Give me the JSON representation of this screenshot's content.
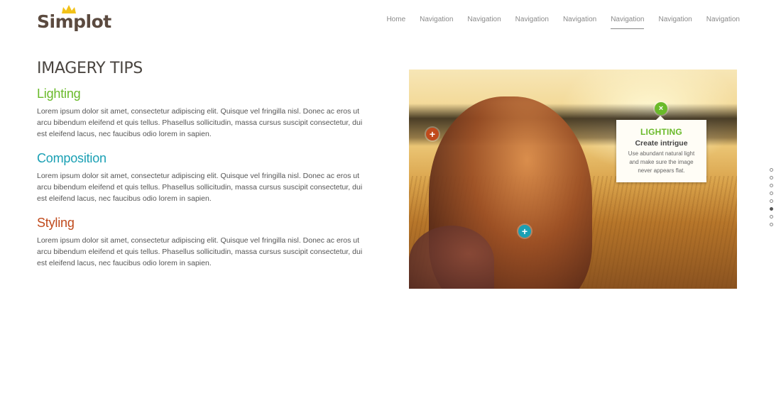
{
  "brand": {
    "name": "Simplot",
    "crown_color": "#f2c218"
  },
  "nav": {
    "items": [
      {
        "label": "Home",
        "active": false
      },
      {
        "label": "Navigation",
        "active": false
      },
      {
        "label": "Navigation",
        "active": false
      },
      {
        "label": "Navigation",
        "active": false
      },
      {
        "label": "Navigation",
        "active": false
      },
      {
        "label": "Navigation",
        "active": true
      },
      {
        "label": "Navigation",
        "active": false
      },
      {
        "label": "Navigation",
        "active": false
      }
    ]
  },
  "main": {
    "title": "IMAGERY TIPS",
    "sections": [
      {
        "heading": "Lighting",
        "color": "#6aba2a",
        "body": "Lorem ipsum dolor sit amet, consectetur adipiscing elit. Quisque vel fringilla nisl. Donec ac eros ut arcu bibendum eleifend et quis tellus. Phasellus sollicitudin, massa cursus suscipit consectetur, dui est eleifend lacus, nec faucibus odio lorem in sapien."
      },
      {
        "heading": "Composition",
        "color": "#1aa0b4",
        "body": "Lorem ipsum dolor sit amet, consectetur adipiscing elit. Quisque vel fringilla nisl. Donec ac eros ut arcu bibendum eleifend et quis tellus. Phasellus sollicitudin, massa cursus suscipit consectetur, dui est eleifend lacus, nec faucibus odio lorem in sapien."
      },
      {
        "heading": "Styling",
        "color": "#c04a1c",
        "body": "Lorem ipsum dolor sit amet, consectetur adipiscing elit. Quisque vel fringilla nisl. Donec ac eros ut arcu bibendum eleifend et quis tellus. Phasellus sollicitudin, massa cursus suscipit consectetur, dui est eleifend lacus, nec faucibus odio lorem in sapien."
      }
    ]
  },
  "image": {
    "hotspots": [
      {
        "name": "styling",
        "symbol": "+",
        "color": "#c04a1c"
      },
      {
        "name": "composition",
        "symbol": "+",
        "color": "#1aa0b4"
      },
      {
        "name": "lighting",
        "symbol": "×",
        "color": "#6aba2a"
      }
    ],
    "tooltip": {
      "title": "LIGHTING",
      "subtitle": "Create intrigue",
      "body": "Use abundant natural light and make sure the image never appears flat."
    }
  },
  "pager": {
    "count": 8,
    "active_index": 5
  }
}
